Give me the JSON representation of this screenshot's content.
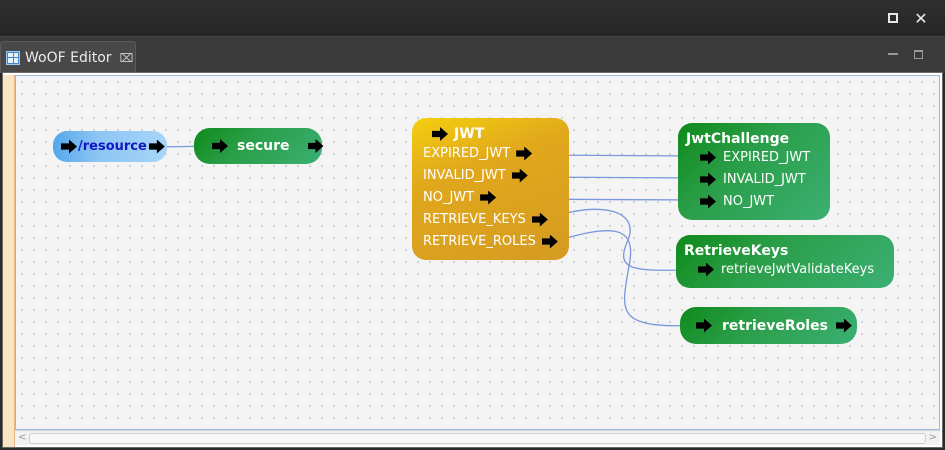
{
  "window": {
    "maximize_icon": "maximize-icon"
  },
  "tab": {
    "label": "WoOF Editor",
    "close_glyph": "⌧",
    "icon": "woof-editor-icon"
  },
  "colors": {
    "link": "#7a96de",
    "green": "#2a9e48",
    "gold": "#e1a81c",
    "blue": "#8cc6f4"
  },
  "nodes": {
    "resource": {
      "label": "/resource"
    },
    "secure": {
      "label": "secure"
    },
    "jwt": {
      "title": "JWT",
      "outputs": [
        "EXPIRED_JWT",
        "INVALID_JWT",
        "NO_JWT",
        "RETRIEVE_KEYS",
        "RETRIEVE_ROLES"
      ]
    },
    "jwtChallenge": {
      "title": "JwtChallenge",
      "inputs": [
        "EXPIRED_JWT",
        "INVALID_JWT",
        "NO_JWT"
      ]
    },
    "retrieveKeys": {
      "title": "RetrieveKeys",
      "inputs": [
        "retrieveJwtValidateKeys"
      ]
    },
    "retrieveRoles": {
      "label": "retrieveRoles"
    }
  },
  "links": [
    {
      "from": "resource.out",
      "to": "secure.in"
    },
    {
      "from": "jwt.EXPIRED_JWT",
      "to": "jwtChallenge.EXPIRED_JWT"
    },
    {
      "from": "jwt.INVALID_JWT",
      "to": "jwtChallenge.INVALID_JWT"
    },
    {
      "from": "jwt.NO_JWT",
      "to": "jwtChallenge.NO_JWT"
    },
    {
      "from": "jwt.RETRIEVE_KEYS",
      "to": "retrieveKeys.retrieveJwtValidateKeys"
    },
    {
      "from": "jwt.RETRIEVE_ROLES",
      "to": "retrieveRoles.in"
    }
  ]
}
